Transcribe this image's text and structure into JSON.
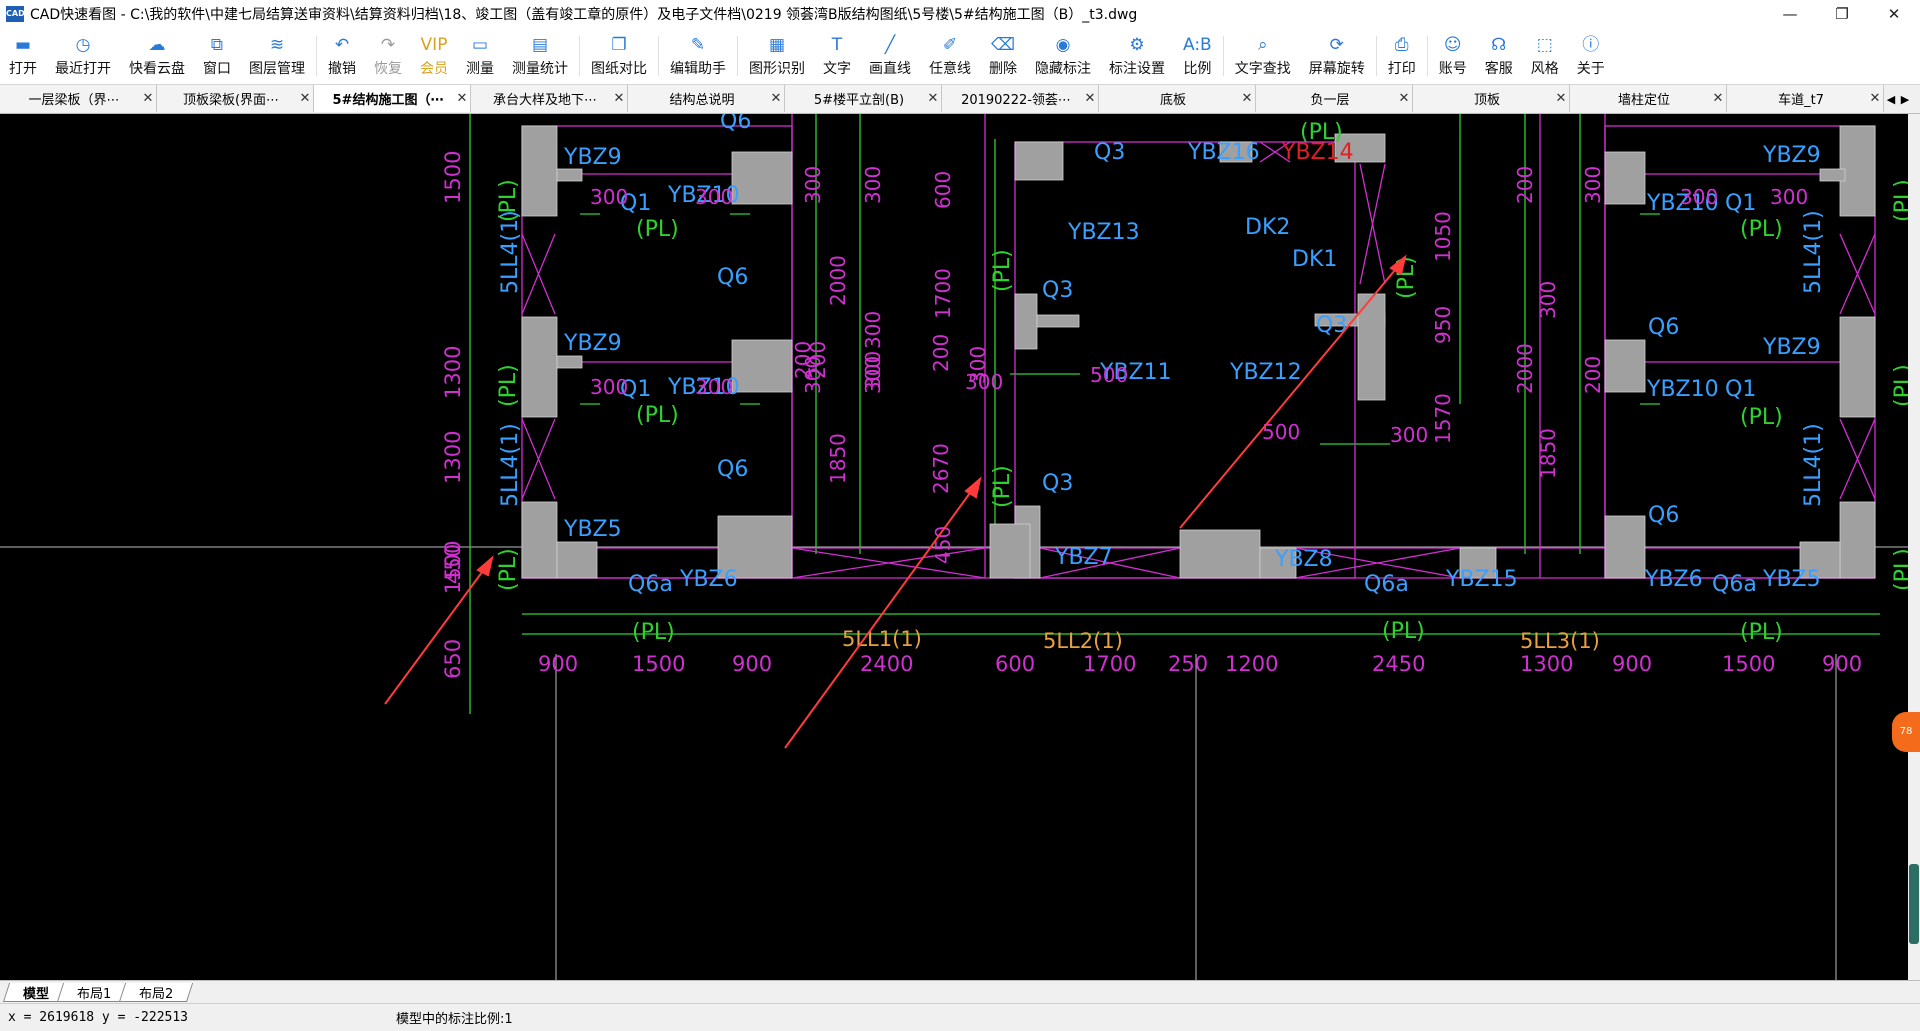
{
  "window": {
    "icon_label": "CAD",
    "title": "CAD快速看图 - C:\\我的软件\\中建七局结算送审资料\\结算资料归档\\18、竣工图（盖有竣工章的原件）及电子文件档\\0219 领荟湾B版结构图纸\\5号楼\\5#结构施工图（B）_t3.dwg",
    "controls": [
      "—",
      "❐",
      "✕"
    ]
  },
  "toolbar": [
    {
      "label": "打开",
      "icon": "folder-icon",
      "glyph": "▬",
      "state": "normal"
    },
    {
      "label": "最近打开",
      "icon": "clock-icon",
      "glyph": "◷",
      "state": "normal"
    },
    {
      "label": "快看云盘",
      "icon": "cloud-icon",
      "glyph": "☁",
      "state": "normal"
    },
    {
      "label": "窗口",
      "icon": "window-icon",
      "glyph": "⧉",
      "state": "normal"
    },
    {
      "label": "图层管理",
      "icon": "layers-icon",
      "glyph": "≋",
      "state": "normal"
    },
    {
      "label": "撤销",
      "icon": "undo-icon",
      "glyph": "↶",
      "state": "normal"
    },
    {
      "label": "恢复",
      "icon": "redo-icon",
      "glyph": "↷",
      "state": "disabled"
    },
    {
      "label": "会员",
      "icon": "vip-icon",
      "glyph": "VIP",
      "state": "vip"
    },
    {
      "label": "测量",
      "icon": "ruler-icon",
      "glyph": "▭",
      "state": "normal"
    },
    {
      "label": "测量统计",
      "icon": "measure-stats-icon",
      "glyph": "▤",
      "state": "normal"
    },
    {
      "label": "图纸对比",
      "icon": "compare-icon",
      "glyph": "❐",
      "state": "normal"
    },
    {
      "label": "编辑助手",
      "icon": "edit-assistant-icon",
      "glyph": "✎",
      "state": "normal"
    },
    {
      "label": "图形识别",
      "icon": "shape-recognition-icon",
      "glyph": "▦",
      "state": "normal"
    },
    {
      "label": "文字",
      "icon": "text-icon",
      "glyph": "T",
      "state": "normal"
    },
    {
      "label": "画直线",
      "icon": "line-icon",
      "glyph": "╱",
      "state": "normal"
    },
    {
      "label": "任意线",
      "icon": "freehand-icon",
      "glyph": "✐",
      "state": "normal"
    },
    {
      "label": "删除",
      "icon": "eraser-icon",
      "glyph": "⌫",
      "state": "normal"
    },
    {
      "label": "隐藏标注",
      "icon": "eye-icon",
      "glyph": "◉",
      "state": "normal"
    },
    {
      "label": "标注设置",
      "icon": "annotation-settings-icon",
      "glyph": "⚙",
      "state": "normal"
    },
    {
      "label": "比例",
      "icon": "scale-icon",
      "glyph": "A:B",
      "state": "normal"
    },
    {
      "label": "文字查找",
      "icon": "text-search-icon",
      "glyph": "⌕",
      "state": "normal"
    },
    {
      "label": "屏幕旋转",
      "icon": "rotate-icon",
      "glyph": "⟳",
      "state": "normal"
    },
    {
      "label": "打印",
      "icon": "printer-icon",
      "glyph": "⎙",
      "state": "normal"
    },
    {
      "label": "账号",
      "icon": "user-icon",
      "glyph": "☺",
      "state": "normal"
    },
    {
      "label": "客服",
      "icon": "headset-icon",
      "glyph": "☊",
      "state": "normal"
    },
    {
      "label": "风格",
      "icon": "style-icon",
      "glyph": "⬚",
      "state": "normal"
    },
    {
      "label": "关于",
      "icon": "info-icon",
      "glyph": "ⓘ",
      "state": "normal"
    }
  ],
  "tabs": [
    {
      "label": "一层梁板（界⋯",
      "close": "✕",
      "active": false
    },
    {
      "label": "顶板梁板(界面⋯",
      "close": "✕",
      "active": false
    },
    {
      "label": "5#结构施工图（⋯",
      "close": "✕",
      "active": true
    },
    {
      "label": "承台大样及地下⋯",
      "close": "✕",
      "active": false
    },
    {
      "label": "结构总说明",
      "close": "✕",
      "active": false
    },
    {
      "label": "5#楼平立剖(B)",
      "close": "✕",
      "active": false
    },
    {
      "label": "20190222-领荟⋯",
      "close": "✕",
      "active": false
    },
    {
      "label": "底板",
      "close": "✕",
      "active": false
    },
    {
      "label": "负一层",
      "close": "✕",
      "active": false
    },
    {
      "label": "顶板",
      "close": "✕",
      "active": false
    },
    {
      "label": "墙柱定位",
      "close": "✕",
      "active": false
    },
    {
      "label": "车道_t7",
      "close": "✕",
      "active": false
    }
  ],
  "tab_nav": {
    "prev": "◀",
    "next": "▶"
  },
  "drawing": {
    "labels_blue": [
      "Q6",
      "YBZ9",
      "Q1",
      "YBZ10",
      "Q6",
      "YBZ9",
      "Q1",
      "YBZ10",
      "Q6",
      "YBZ5",
      "Q6a",
      "YBZ6",
      "Q3",
      "YBZ16",
      "YBZ13",
      "DK2",
      "DK1",
      "Q3",
      "Q3",
      "YBZ11",
      "YBZ12",
      "Q3",
      "YBZ7",
      "YBZ8",
      "Q6a",
      "YBZ15",
      "YBZ9",
      "YBZ10",
      "Q1",
      "Q6",
      "YBZ9",
      "YBZ10",
      "Q1",
      "Q6",
      "YBZ6",
      "Q6a",
      "YBZ5",
      "5LL4(1)",
      "5LL4(1)",
      "5LL4(1)",
      "5LL4(1)",
      "5L"
    ],
    "labels_red": [
      "YBZ14"
    ],
    "labels_green": [
      "(PL)",
      "(PL)",
      "(PL)",
      "(PL)",
      "(PL)",
      "(PL)",
      "(PL)",
      "(PL)",
      "(PL)",
      "(PL)",
      "(PL)",
      "(PL)",
      "(PL)",
      "(PL)",
      "(PL)",
      "(PL)",
      "(PL)"
    ],
    "labels_beam": [
      "5LL1(1)",
      "5LL2(1)",
      "5LL3(1)"
    ],
    "dims_bottom": [
      "900",
      "1500",
      "900",
      "2400",
      "600",
      "1700",
      "250",
      "1200",
      "2450",
      "1300",
      "900",
      "1500",
      "900"
    ],
    "dims_left": [
      "1500",
      "1300",
      "1500",
      "1300",
      "650",
      "450"
    ],
    "dims_misc": [
      "300",
      "300",
      "300",
      "300",
      "300",
      "300",
      "300",
      "300",
      "500",
      "500",
      "300",
      "200",
      "300",
      "200",
      "300",
      "2000",
      "1850",
      "600",
      "1700",
      "200",
      "300",
      "2670",
      "300",
      "450",
      "1050",
      "950",
      "1570",
      "200",
      "300",
      "2000",
      "200",
      "300",
      "1850",
      "300",
      "300"
    ]
  },
  "layout_tabs": [
    "模型",
    "布局1",
    "布局2"
  ],
  "status": {
    "coords": "x = 2619618 y = -222513",
    "scale": "模型中的标注比例:1"
  },
  "float_badge": "78",
  "colors": {
    "canvas": "#000000",
    "wall": "#a0a0a0",
    "magenta": "#d030d0",
    "green": "#30d030",
    "blue": "#3aa0ff",
    "red": "#e02020",
    "arrow": "#ff3b3b",
    "beam_label": "#e8a040"
  }
}
